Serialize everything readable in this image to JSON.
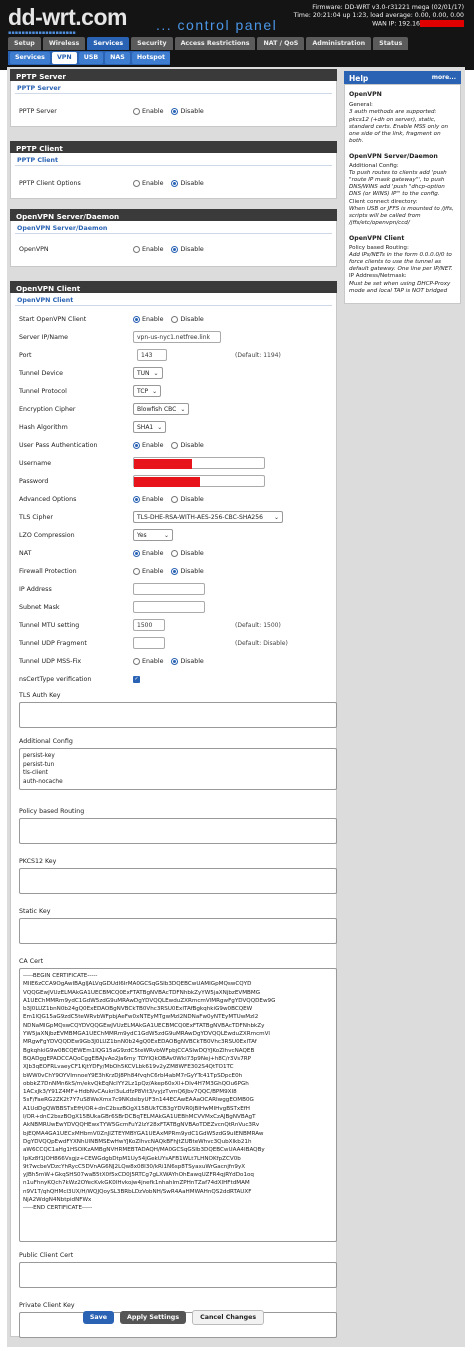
{
  "header": {
    "logo": "dd-wrt.com",
    "subtitle": "... control panel",
    "firmware": "Firmware: DD-WRT v3.0-r31221 mega (02/01/17)",
    "time": "Time: 20:21:04 up 1:23, load average: 0.00, 0.00, 0.00",
    "wan_ip": "WAN IP: 192.16"
  },
  "nav_main": [
    "Setup",
    "Wireless",
    "Services",
    "Security",
    "Access Restrictions",
    "NAT / QoS",
    "Administration",
    "Status"
  ],
  "nav_sub": [
    "Services",
    "VPN",
    "USB",
    "NAS",
    "Hotspot"
  ],
  "radio_labels": {
    "enable": "Enable",
    "disable": "Disable"
  },
  "pptp_server": {
    "title": "PPTP Server",
    "sub": "PPTP Server",
    "label": "PPTP Server"
  },
  "pptp_client": {
    "title": "PPTP Client",
    "sub": "PPTP Client",
    "label": "PPTP Client Options"
  },
  "openvpn_server": {
    "title": "OpenVPN Server/Daemon",
    "sub": "OpenVPN Server/Daemon",
    "label": "OpenVPN"
  },
  "openvpn_client": {
    "title": "OpenVPN Client",
    "sub": "OpenVPN Client",
    "start_label": "Start OpenVPN Client",
    "server_label": "Server IP/Name",
    "server_value": "vpn-us-nyc1.netfree.link",
    "port_label": "Port",
    "port_value": "143",
    "port_default": "(Default: 1194)",
    "tunnel_device_label": "Tunnel Device",
    "tunnel_device_value": "TUN",
    "tunnel_protocol_label": "Tunnel Protocol",
    "tunnel_protocol_value": "TCP",
    "cipher_label": "Encryption Cipher",
    "cipher_value": "Blowfish CBC",
    "hash_label": "Hash Algorithm",
    "hash_value": "SHA1",
    "userpass_label": "User Pass Authentication",
    "username_label": "Username",
    "password_label": "Password",
    "advanced_label": "Advanced Options",
    "tls_cipher_label": "TLS Cipher",
    "tls_cipher_value": "TLS-DHE-RSA-WITH-AES-256-CBC-SHA256",
    "lzo_label": "LZO Compression",
    "lzo_value": "Yes",
    "nat_label": "NAT",
    "firewall_label": "Firewall Protection",
    "ip_label": "IP Address",
    "subnet_label": "Subnet Mask",
    "mtu_label": "Tunnel MTU setting",
    "mtu_value": "1500",
    "mtu_default": "(Default: 1500)",
    "udp_frag_label": "Tunnel UDP Fragment",
    "udp_frag_default": "(Default: Disable)",
    "mssfix_label": "Tunnel UDP MSS-Fix",
    "nscert_label": "nsCertType verification",
    "tls_auth_label": "TLS Auth Key",
    "additional_label": "Additional Config",
    "additional_value": "persist-key\npersist-tun\ntls-client\nauth-nocache",
    "policy_label": "Policy based Routing",
    "pkcs_label": "PKCS12 Key",
    "static_label": "Static Key",
    "ca_label": "CA Cert",
    "ca_value": "-----BEGIN CERTIFICATE-----\nMIIE6zCCA9OgAwIBAgIJALVqGDUdI6IrMA0GCSqGSIb3DQEBCwUAMIGpMQswCQYD\nVQQGEwJVUzELMAkGA1UECBMCQ0ExFTATBgNVBAcTDFNhbkZyYW5jaXNjbzEVMBMG\nA1UEChMMRm9ydC1GdW5zdG9uMRAwDgYDVQQLEwduZXRmcmVlMRgwFgYDVQQDEw9G\nb3J0LUZ1bnN0b24gQ0ExEDAOBgNVBCkTB0Vhc3RSU0ExITAfBgkqhkiG9w0BCQEW\nEm1lQG15aG9zdC5teWRvbWFpbjAeFw0xNTEyMTgwMzI2NDNaFw0yNTEyMTUwMzI2\nNDNaMIGpMQswCQYDVQQGEwJVUzELMAkGA1UECBMCQ0ExFTATBgNVBAcTDFNhbkZy\nYW5jaXNjbzEVMBMGA1UEChMMRm9ydC1GdW5zdG9uMRAwDgYDVQQLEwduZXRmcmVl\nMRgwFgYDVQQDEw9Gb3J0LUZ1bnN0b24gQ0ExEDAOBgNVBCkTB0Vhc3RSU0ExITAf\nBgkqhkiG9w0BCQEWEm1lQG15aG9zdC5teWRvbWFpbjCCASIwDQYJKoZIhvcNAQEB\nBQADggEPADCCAQoCggEBAJvAo2Ja6my TDYIQkOBAv0Wki73p9Nej+h8C/r3Vs7RP\nXJb3qEOFRLvaeyCF1KjtYDFy/MbOh5KCVLbk619v2yZM8WFE302S4QtTO1TC\nbWW0vChY9OYVImnoeY9E3hKrzDJ8Ph84fvqhC6rbI4abM7rGyYTc41TpSDpcE0h\nobbkZ7DnNMn6kS/m/ekvQkEqNcIYY2Lz1pQz/Akep60xXl+Dlv4H7M3GhQOu6PGh\n1ACxJk3/Y91Z4MF+HdbNvCAukrl3uLdfzP8Vit3/vyjzTvmQ6Jbv7QQC/BPM9XI8\n5sF/FaeRG2ZK2t7Y7uS8WeXmx7c9NKdsibyUF3n144ECAwEAAaOCARIwggEOMB0G\nA1UdDgQWBBSTxEfH/OR+dnC2bszBOgX15BUkTCB3gYDVR0jBIHwMIHvgBSTxEfH\nI/OR+dnC2bszBOgX15BUkaGBr6SBrDCBqTELMAkGA1UEBhMCVVMxCzAJBgNVBAgT\nAkNBMRUwEwYDVQQHEwxTYW5GcmFuY2lzY28xFTATBgNVBAoTDEZvcnQtRnVuc3Rv\nbjEQMA4GA1UECxMHbmV0ZnJlZTEYMBYGA1UEAxMPRm9ydC1GdW5zdG9uIENBMRAw\nDgYDVQQpEwdFYXNhUlNBMSEwHwYJKoZIhvcNAQkBFhJtZUBteWhvc3QubXlkb21h\naW6CCQC1aHg1HSOlKzAMBgNVHRMEBTADAQH/MA0GCSqGSIb3DQEBCwUAA4IBAQBy\nIpKz8f1JOH866Vsgjz+CEWGdgbDtpM1Uy54jGekUYsAFB1WLt7LHNOKfpZCV0b\n9t7wcbeVDzcYhRycC5DVnAG6NJ2LQw8x08I30/kRi1N6sp8TSyaxuWrGacnjfn9yX\nyJBh5mW+GkqSHS07waB5tX0f5xCD0J5RTCg7gLXWAYhOhEawqUZFR4qjRYdDo1oq\nn1uFhnyKQch7kWz2OYecKvkGK0lHvkojw4jnefk1nhahlmZPHnTZaf74dXlHFtdMAM\nn9V1T/qhQHMcI3UX/H/WQJQoySL3BRbLDzVobNH/SwR4AaHMWAHnQS2ddRTAUXF\nNjA2WdgN4NbtpidNFWx\n-----END CERTIFICATE-----",
    "public_cert_label": "Public Client Cert",
    "private_key_label": "Private Client Key"
  },
  "help": {
    "title": "Help",
    "more": "more...",
    "openvpn_title": "OpenVPN",
    "openvpn_general_label": "General:",
    "openvpn_general_text": "3 auth methods are supported: pkcs12 (+dh on server), static, standard certs. Enable MSS only on one side of the link, fragment on both.",
    "daemon_title": "OpenVPN Server/Daemon",
    "daemon_add_label": "Additional Config:",
    "daemon_add_text": "To push routes to clients add 'push \"route IP mask gateway\"', to push DNS/WINS add 'push \"dhcp-option DNS (or WINS) IP\"' to the config.",
    "daemon_ccd_label": "Client connect directory:",
    "daemon_ccd_text": "When USB or JFFS is mounted to /jffs, scripts will be called from /jffs/etc/openvpn/ccd/",
    "client_title": "OpenVPN Client",
    "client_policy_label": "Policy based Routing:",
    "client_policy_text": "Add IPs/NETs in the form 0.0.0.0/0 to force clients to use the tunnel as default gateway. One line per IP/NET.",
    "client_ip_label": "IP Address/Netmask:",
    "client_ip_text": "Must be set when using DHCP-Proxy mode and local TAP is NOT bridged"
  },
  "buttons": {
    "save": "Save",
    "apply": "Apply Settings",
    "cancel": "Cancel Changes"
  },
  "colors": {
    "accent": "#2a63b4",
    "header_bg": "#141414",
    "redaction": "#e8141b"
  }
}
